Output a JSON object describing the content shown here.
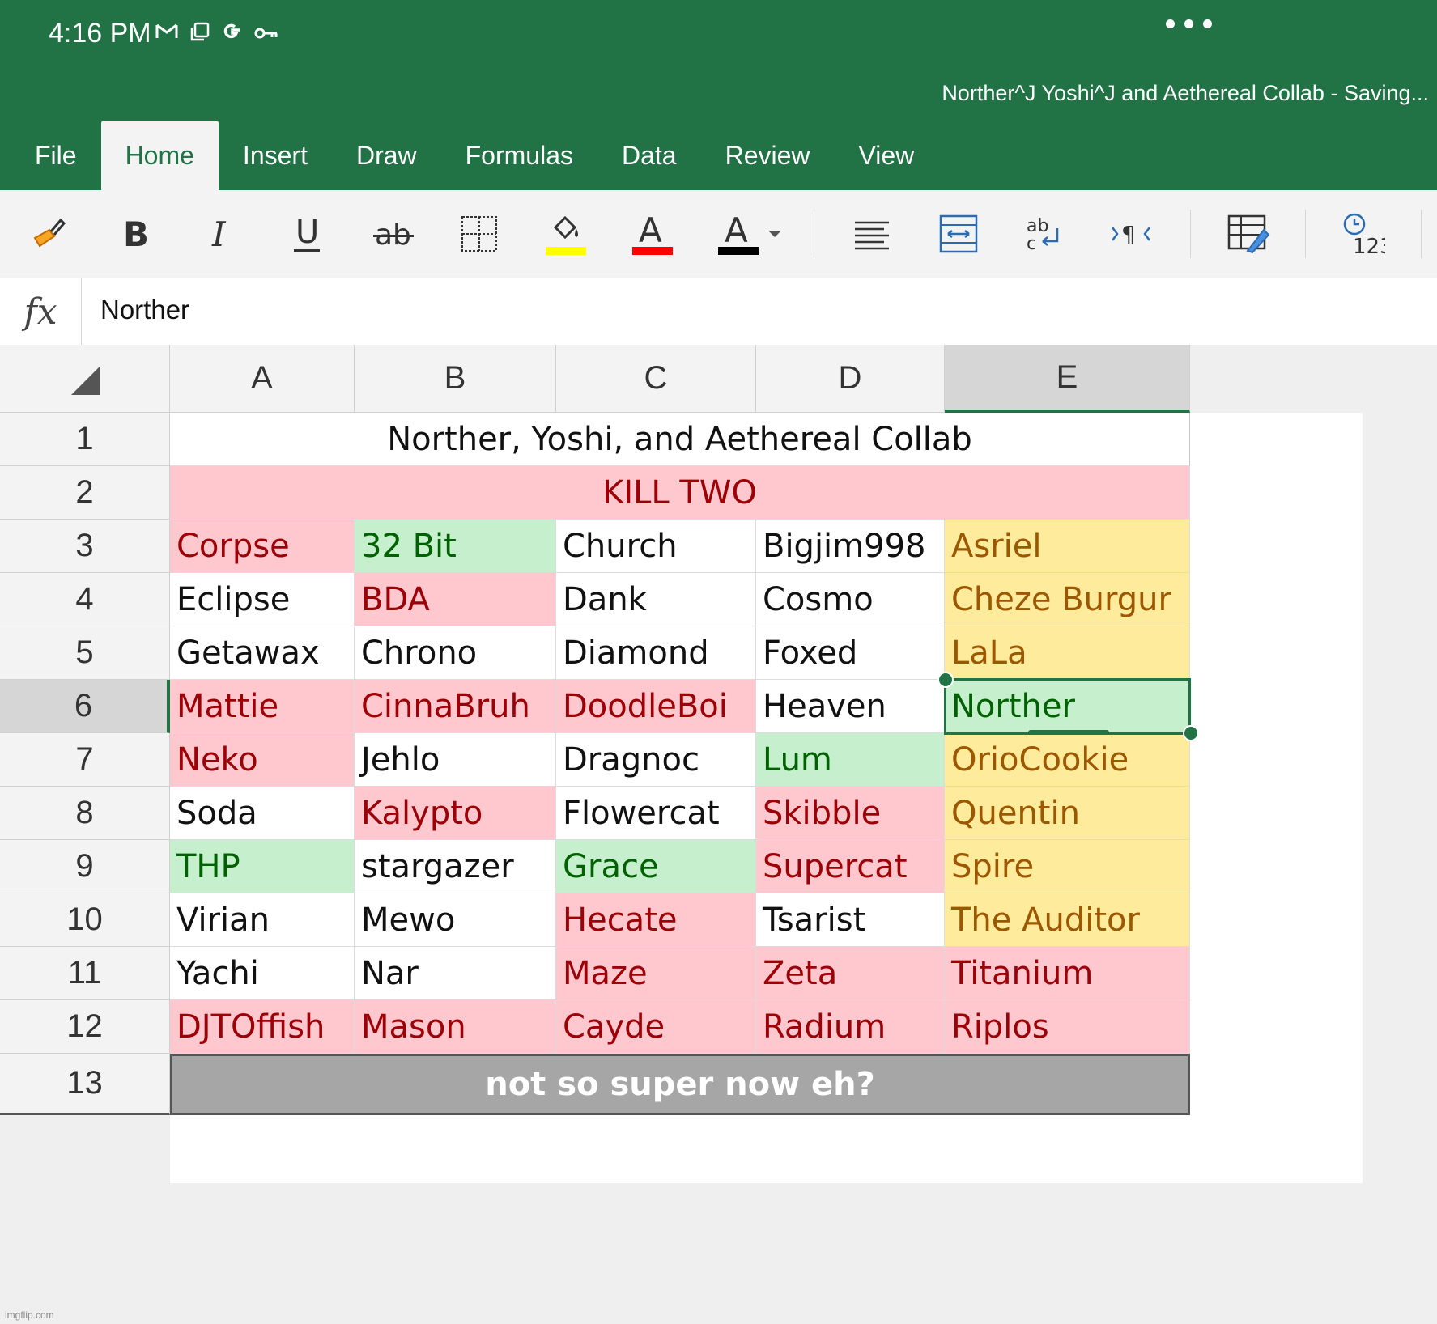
{
  "status_bar": {
    "time": "4:16 PM"
  },
  "document": {
    "title": "Norther^J Yoshi^J and Aethereal Collab - Saving..."
  },
  "ribbon": {
    "tabs": [
      "File",
      "Home",
      "Insert",
      "Draw",
      "Formulas",
      "Data",
      "Review",
      "View"
    ],
    "active_tab": "Home",
    "tools": [
      "format-painter-icon",
      "bold-icon",
      "italic-icon",
      "underline-icon",
      "strikethrough-icon",
      "borders-icon",
      "fill-color-icon",
      "font-color-icon",
      "font-color-dropdown-icon",
      "align-icon",
      "merge-icon",
      "wrap-text-icon",
      "text-direction-icon",
      "format-table-icon",
      "number-format-icon"
    ],
    "fill_color": "#ffff00",
    "font_color": "#ff0000"
  },
  "formula_bar": {
    "fx_label": "fx",
    "value": "Norther"
  },
  "sheet": {
    "columns": [
      "A",
      "B",
      "C",
      "D",
      "E"
    ],
    "selected_column": "E",
    "rows": [
      "1",
      "2",
      "3",
      "4",
      "5",
      "6",
      "7",
      "8",
      "9",
      "10",
      "11",
      "12",
      "13"
    ],
    "selected_row": "6",
    "title": "Norther, Yoshi, and Aethereal Collab",
    "banner": "KILL TWO",
    "grid": [
      [
        "Corpse",
        "32 Bit",
        "Church",
        "Bigjim998",
        "Asriel"
      ],
      [
        "Eclipse",
        "BDA",
        "Dank",
        "Cosmo",
        "Cheze Burgur"
      ],
      [
        "Getawax",
        "Chrono",
        "Diamond",
        "Foxed",
        "LaLa"
      ],
      [
        "Mattie",
        "CinnaBruh",
        "DoodleBoi",
        "Heaven",
        "Norther"
      ],
      [
        "Neko",
        "Jehlo",
        "Dragnoc",
        "Lum",
        "OrioCookie"
      ],
      [
        "Soda",
        "Kalypto",
        "Flowercat",
        "Skibble",
        "Quentin"
      ],
      [
        "THP",
        "stargazer",
        "Grace",
        "Supercat",
        "Spire"
      ],
      [
        "Virian",
        "Mewo",
        "Hecate",
        "Tsarist",
        "The Auditor"
      ],
      [
        "Yachi",
        "Nar",
        "Maze",
        "Zeta",
        "Titanium"
      ],
      [
        "DJTOffish",
        "Mason",
        "Cayde",
        "Radium",
        "Riplos"
      ]
    ],
    "styles": [
      [
        "red",
        "green",
        "white",
        "white",
        "yellow"
      ],
      [
        "white",
        "red",
        "white",
        "white",
        "yellow"
      ],
      [
        "white",
        "white",
        "white",
        "white",
        "yellow"
      ],
      [
        "red",
        "red",
        "red",
        "white",
        "green"
      ],
      [
        "red",
        "white",
        "white",
        "green",
        "yellow"
      ],
      [
        "white",
        "red",
        "white",
        "red",
        "yellow"
      ],
      [
        "green",
        "white",
        "green",
        "red",
        "yellow"
      ],
      [
        "white",
        "white",
        "red",
        "white",
        "yellow"
      ],
      [
        "white",
        "white",
        "red",
        "red",
        "red"
      ],
      [
        "red",
        "red",
        "red",
        "red",
        "red"
      ]
    ],
    "footer": "not so super now eh?",
    "colors": {
      "red_fill": "#ffc7ce",
      "red_text": "#9c0006",
      "green_fill": "#c6efce",
      "green_text": "#006100",
      "yellow_fill": "#ffeb9c",
      "yellow_text": "#9c5700",
      "accent": "#217346"
    }
  },
  "watermark": "imgflip.com"
}
